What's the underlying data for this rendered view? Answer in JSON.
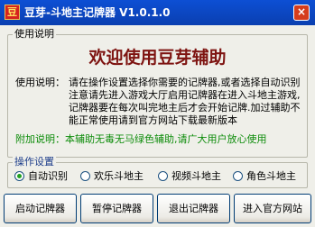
{
  "window": {
    "title": "豆芽-斗地主记牌器 V1.0.1.0",
    "icon_glyph": "豆",
    "close_glyph": "×"
  },
  "usage": {
    "group_title": "使用说明",
    "welcome": "欢迎使用豆芽辅助",
    "label": "使用说明：",
    "text": "请在操作设置选择你需要的记牌器,或者选择自动识别注意请先进入游戏大厅启用记牌器在进入斗地主游戏,记牌器要在每次叫完地主后才会开始记牌.加过辅助不能正常使用请到官方网站下载最新版本",
    "note": "附加说明：本辅助无毒无马绿色辅助,请广大用户放心使用"
  },
  "settings": {
    "group_title": "操作设置",
    "options": [
      {
        "label": "自动识别",
        "selected": true
      },
      {
        "label": "欢乐斗地主",
        "selected": false
      },
      {
        "label": "视频斗地主",
        "selected": false
      },
      {
        "label": "角色斗地主",
        "selected": false
      }
    ]
  },
  "buttons": {
    "start": "启动记牌器",
    "pause": "暂停记牌器",
    "exit": "退出记牌器",
    "website": "进入官方网站"
  },
  "colors": {
    "titlebar": "#0a46c4",
    "welcome": "#7e1411",
    "note": "#0d8c0a"
  }
}
